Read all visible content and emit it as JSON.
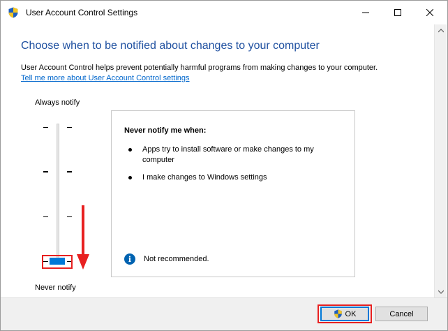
{
  "window": {
    "title": "User Account Control Settings"
  },
  "content": {
    "heading": "Choose when to be notified about changes to your computer",
    "description": "User Account Control helps prevent potentially harmful programs from making changes to your computer.",
    "learn_more_link": "Tell me more about User Account Control settings"
  },
  "slider": {
    "top_label": "Always notify",
    "bottom_label": "Never notify",
    "levels": 4,
    "selected_level": 1
  },
  "panel": {
    "title": "Never notify me when:",
    "bullets": [
      "Apps try to install software or make changes to my computer",
      "I make changes to Windows settings"
    ],
    "recommendation": "Not recommended."
  },
  "footer": {
    "ok_label": "OK",
    "cancel_label": "Cancel"
  },
  "colors": {
    "heading": "#1f50a0",
    "link": "#0066cc",
    "accent": "#0078d7",
    "annotation": "#e82020"
  }
}
